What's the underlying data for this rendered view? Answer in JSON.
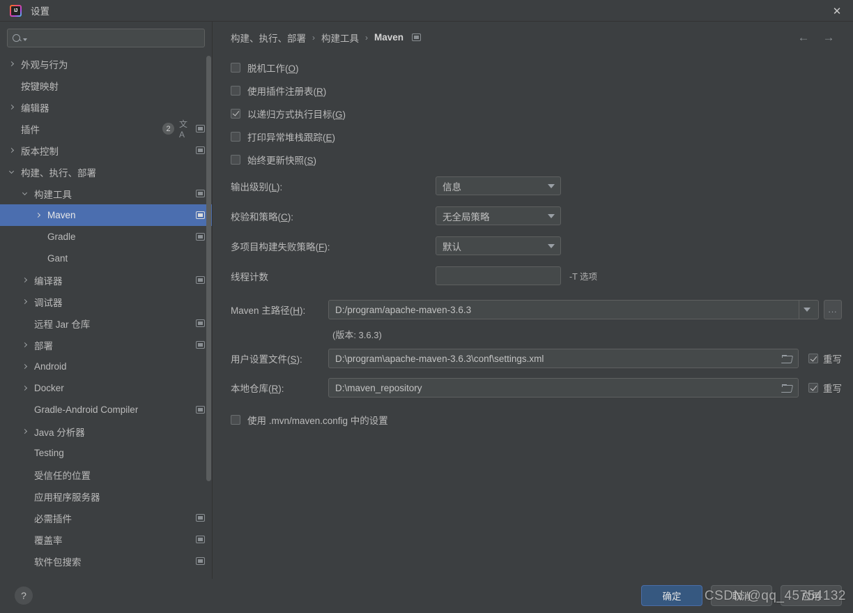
{
  "window": {
    "title": "设置",
    "logo_icon": "intellij-idea-logo",
    "close_icon": "close-icon"
  },
  "sidebar": {
    "search": {
      "placeholder": "",
      "value": "",
      "icon": "search-icon",
      "caret_icon": "chevron-down-icon"
    },
    "items": [
      {
        "label": "外观与行为",
        "indent": 0,
        "twisty": "right",
        "scope_icon": false,
        "selected": false
      },
      {
        "label": "按键映射",
        "indent": 0,
        "twisty": "none",
        "scope_icon": false,
        "selected": false
      },
      {
        "label": "编辑器",
        "indent": 0,
        "twisty": "right",
        "scope_icon": false,
        "selected": false
      },
      {
        "label": "插件",
        "indent": 0,
        "twisty": "none",
        "scope_icon": true,
        "selected": false,
        "badge": "2",
        "translate_icon": true
      },
      {
        "label": "版本控制",
        "indent": 0,
        "twisty": "right",
        "scope_icon": true,
        "selected": false
      },
      {
        "label": "构建、执行、部署",
        "indent": 0,
        "twisty": "down",
        "scope_icon": false,
        "selected": false
      },
      {
        "label": "构建工具",
        "indent": 1,
        "twisty": "down",
        "scope_icon": true,
        "selected": false
      },
      {
        "label": "Maven",
        "indent": 2,
        "twisty": "right",
        "scope_icon": true,
        "selected": true
      },
      {
        "label": "Gradle",
        "indent": 2,
        "twisty": "none",
        "scope_icon": true,
        "selected": false
      },
      {
        "label": "Gant",
        "indent": 2,
        "twisty": "none",
        "scope_icon": false,
        "selected": false
      },
      {
        "label": "编译器",
        "indent": 1,
        "twisty": "right",
        "scope_icon": true,
        "selected": false
      },
      {
        "label": "调试器",
        "indent": 1,
        "twisty": "right",
        "scope_icon": false,
        "selected": false
      },
      {
        "label": "远程 Jar 仓库",
        "indent": 1,
        "twisty": "none",
        "scope_icon": true,
        "selected": false
      },
      {
        "label": "部署",
        "indent": 1,
        "twisty": "right",
        "scope_icon": true,
        "selected": false
      },
      {
        "label": "Android",
        "indent": 1,
        "twisty": "right",
        "scope_icon": false,
        "selected": false
      },
      {
        "label": "Docker",
        "indent": 1,
        "twisty": "right",
        "scope_icon": false,
        "selected": false
      },
      {
        "label": "Gradle-Android Compiler",
        "indent": 1,
        "twisty": "none",
        "scope_icon": true,
        "selected": false
      },
      {
        "label": "Java 分析器",
        "indent": 1,
        "twisty": "right",
        "scope_icon": false,
        "selected": false
      },
      {
        "label": "Testing",
        "indent": 1,
        "twisty": "none",
        "scope_icon": false,
        "selected": false
      },
      {
        "label": "受信任的位置",
        "indent": 1,
        "twisty": "none",
        "scope_icon": false,
        "selected": false
      },
      {
        "label": "应用程序服务器",
        "indent": 1,
        "twisty": "none",
        "scope_icon": false,
        "selected": false
      },
      {
        "label": "必需插件",
        "indent": 1,
        "twisty": "none",
        "scope_icon": true,
        "selected": false
      },
      {
        "label": "覆盖率",
        "indent": 1,
        "twisty": "none",
        "scope_icon": true,
        "selected": false
      },
      {
        "label": "软件包搜索",
        "indent": 1,
        "twisty": "none",
        "scope_icon": true,
        "selected": false
      }
    ]
  },
  "breadcrumb": {
    "items": [
      "构建、执行、部署",
      "构建工具",
      "Maven"
    ],
    "separator": "›",
    "scope_icon": "project-scope-icon",
    "nav_back_icon": "arrow-left-icon",
    "nav_forward_icon": "arrow-right-icon"
  },
  "main": {
    "checkboxes": [
      {
        "label_pre": "脱机工作(",
        "mnemonic": "O",
        "label_post": ")",
        "checked": false
      },
      {
        "label_pre": "使用插件注册表(",
        "mnemonic": "R",
        "label_post": ")",
        "checked": false
      },
      {
        "label_pre": "以递归方式执行目标(",
        "mnemonic": "G",
        "label_post": ")",
        "checked": true
      },
      {
        "label_pre": "打印异常堆栈跟踪(",
        "mnemonic": "E",
        "label_post": ")",
        "checked": false
      },
      {
        "label_pre": "始终更新快照(",
        "mnemonic": "S",
        "label_post": ")",
        "checked": false
      }
    ],
    "combos": [
      {
        "label_pre": "输出级别(",
        "mnemonic": "L",
        "label_post": "):",
        "value": "信息"
      },
      {
        "label_pre": "校验和策略(",
        "mnemonic": "C",
        "label_post": "):",
        "value": "无全局策略"
      },
      {
        "label_pre": "多项目构建失败策略(",
        "mnemonic": "F",
        "label_post": "):",
        "value": "默认"
      }
    ],
    "thread_count": {
      "label": "线程计数",
      "value": "",
      "note": "-T 选项"
    },
    "maven_home": {
      "label_pre": "Maven 主路径(",
      "mnemonic": "H",
      "label_post": "):",
      "value": "D:/program/apache-maven-3.6.3",
      "dropdown_icon": "chevron-down-icon",
      "browse_label": "...",
      "version_note": "(版本: 3.6.3)"
    },
    "user_settings_file": {
      "label_pre": "用户设置文件(",
      "mnemonic": "S",
      "label_post": "):",
      "value": "D:\\program\\apache-maven-3.6.3\\conf\\settings.xml",
      "folder_icon": "folder-icon",
      "override_label": "重写",
      "override_checked": true
    },
    "local_repository": {
      "label_pre": "本地仓库(",
      "mnemonic": "R",
      "label_post": "):",
      "value": "D:\\maven_repository",
      "folder_icon": "folder-icon",
      "override_label": "重写",
      "override_checked": true
    },
    "mvn_config": {
      "label": "使用 .mvn/maven.config 中的设置",
      "checked": false
    }
  },
  "footer": {
    "help_label": "?",
    "ok_label": "确定",
    "cancel_label": "取消",
    "apply_label": "应用"
  },
  "watermark": {
    "text": "CSDN @qq_45754132"
  },
  "colors": {
    "dialog_bg": "#3c3f41",
    "field_bg": "#45494a",
    "selection_blue": "#4b6eaf",
    "primary_button": "#365880",
    "text": "#bbbbbb"
  }
}
